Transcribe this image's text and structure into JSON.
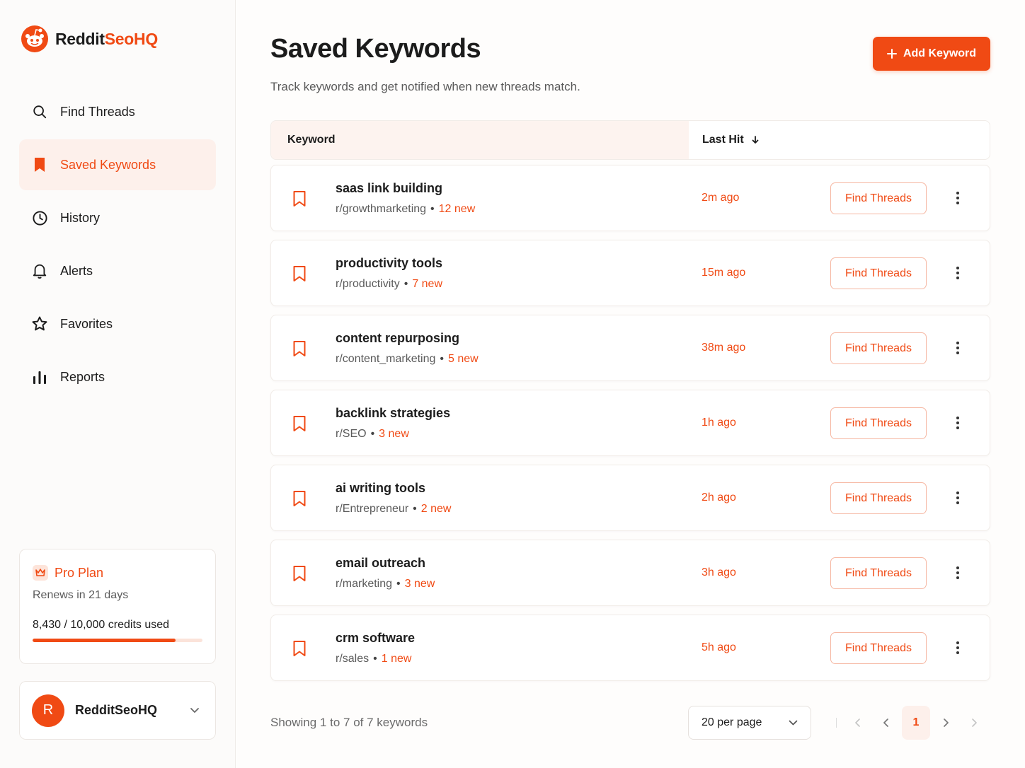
{
  "brand": {
    "name_part1": "Reddit",
    "name_part2": "SeoHQ"
  },
  "sidebar": {
    "items": [
      {
        "label": "Find Threads",
        "icon": "search-icon"
      },
      {
        "label": "Saved Keywords",
        "icon": "bookmark-icon",
        "active": true
      },
      {
        "label": "History",
        "icon": "clock-icon"
      },
      {
        "label": "Alerts",
        "icon": "bell-icon"
      },
      {
        "label": "Favorites",
        "icon": "star-icon"
      },
      {
        "label": "Reports",
        "icon": "bar-chart-icon"
      }
    ]
  },
  "plan": {
    "title": "Pro Plan",
    "renews": "Renews in 21 days",
    "credits": "8,430 / 10,000 credits used",
    "usage_fraction": 0.843
  },
  "user": {
    "initial": "R",
    "name": "RedditSeoHQ"
  },
  "header": {
    "title": "Saved Keywords",
    "subtitle": "Track keywords and get notified when new threads match.",
    "add_label": "Add Keyword"
  },
  "table": {
    "col_keyword": "Keyword",
    "col_last_hit": "Last Hit",
    "action_label": "Find Threads",
    "rows": [
      {
        "keyword": "saas link building",
        "subreddit": "r/growthmarketing",
        "new": "12 new",
        "last_hit": "2m ago"
      },
      {
        "keyword": "productivity tools",
        "subreddit": "r/productivity",
        "new": "7 new",
        "last_hit": "15m ago"
      },
      {
        "keyword": "content repurposing",
        "subreddit": "r/content_marketing",
        "new": "5 new",
        "last_hit": "38m ago"
      },
      {
        "keyword": "backlink strategies",
        "subreddit": "r/SEO",
        "new": "3 new",
        "last_hit": "1h ago"
      },
      {
        "keyword": "ai writing tools",
        "subreddit": "r/Entrepreneur",
        "new": "2 new",
        "last_hit": "2h ago"
      },
      {
        "keyword": "email outreach",
        "subreddit": "r/marketing",
        "new": "3 new",
        "last_hit": "3h ago"
      },
      {
        "keyword": "crm software",
        "subreddit": "r/sales",
        "new": "1 new",
        "last_hit": "5h ago"
      }
    ]
  },
  "footer": {
    "showing": "Showing 1 to 7 of 7 keywords",
    "per_page": "20 per page",
    "current_page": "1"
  },
  "colors": {
    "accent": "#f04a14",
    "accent_light": "#fdf0eb"
  }
}
